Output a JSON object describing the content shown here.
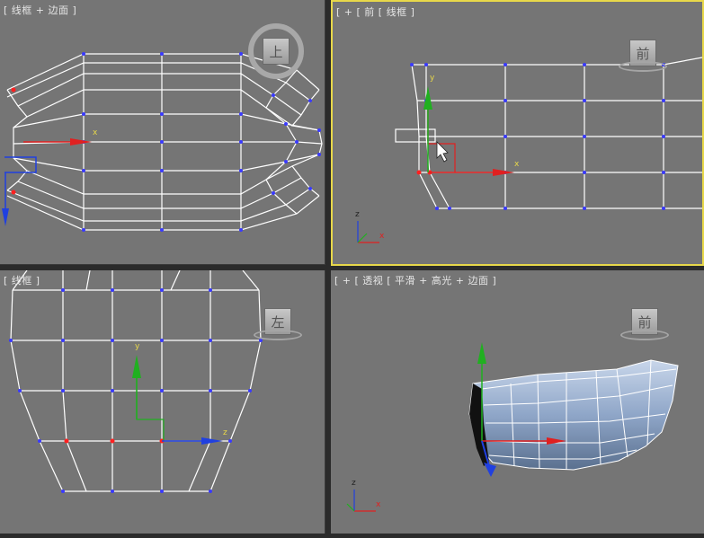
{
  "viewports": {
    "top": {
      "label": "[ 线框 + 边面 ]",
      "cube_label": "上",
      "axis_x": "x"
    },
    "front": {
      "label": "[ + [ 前 [ 线框 ]",
      "cube_label": "前",
      "axis_x": "x",
      "axis_y": "y",
      "tripod_x": "x",
      "tripod_z": "z"
    },
    "left": {
      "label": "[ 线框 ]",
      "cube_label": "左",
      "axis_y": "y",
      "axis_z": "z"
    },
    "perspective": {
      "label": "[ + [ 透视 [ 平滑 + 高光 + 边面 ]",
      "cube_label": "前",
      "tripod_x": "x",
      "tripod_z": "z"
    }
  },
  "colors": {
    "active_border": "#e8d84a",
    "viewport_bg": "#757575",
    "wire": "#ffffff",
    "vertex": "#3a3aff",
    "selected_vertex": "#ff2020",
    "axis_x": "#e02020",
    "axis_y": "#20b020",
    "axis_z": "#2040e0"
  }
}
